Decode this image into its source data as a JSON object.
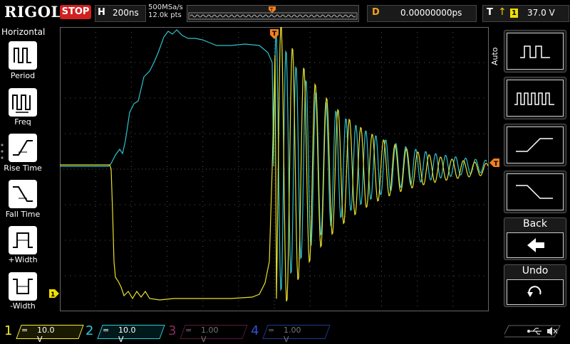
{
  "brand": "RIGOL",
  "run_state": "STOP",
  "horizontal": {
    "label": "H",
    "timebase": "200ns",
    "sample_rate": "500MSa/s",
    "memory_depth": "12.0k pts"
  },
  "delay": {
    "label": "D",
    "value": "0.00000000ps"
  },
  "trigger": {
    "label": "T",
    "edge": "rising",
    "source": "1",
    "level": "37.0 V"
  },
  "left_menu": {
    "title": "Horizontal",
    "items": [
      {
        "label": "Period",
        "icon": "period-icon"
      },
      {
        "label": "Freq",
        "icon": "freq-icon"
      },
      {
        "label": "Rise Time",
        "icon": "rise-time-icon"
      },
      {
        "label": "Fall Time",
        "icon": "fall-time-icon"
      },
      {
        "label": "+Width",
        "icon": "positive-width-icon"
      },
      {
        "label": "-Width",
        "icon": "negative-width-icon"
      }
    ]
  },
  "right_menu": {
    "mode": "Auto",
    "back_label": "Back",
    "undo_label": "Undo"
  },
  "channels": [
    {
      "num": "1",
      "coupling": "=",
      "scale": "10.0 V",
      "color": "#f5ec30",
      "active": true
    },
    {
      "num": "2",
      "coupling": "=",
      "scale": "10.0 V",
      "color": "#2ec9d6",
      "active": true
    },
    {
      "num": "3",
      "coupling": "=",
      "scale": "1.00 V",
      "color": "#c0307a",
      "active": false
    },
    {
      "num": "4",
      "coupling": "=",
      "scale": "1.00 V",
      "color": "#3050d0",
      "active": false
    }
  ],
  "markers": {
    "ch1_ground": "1",
    "trigger_pos": "T",
    "trigger_level": "T"
  },
  "colors": {
    "grid": "#444444",
    "ch1": "#e8e02a",
    "ch2": "#2ec2cc",
    "trigger": "#f08020",
    "stop": "#d12020"
  }
}
